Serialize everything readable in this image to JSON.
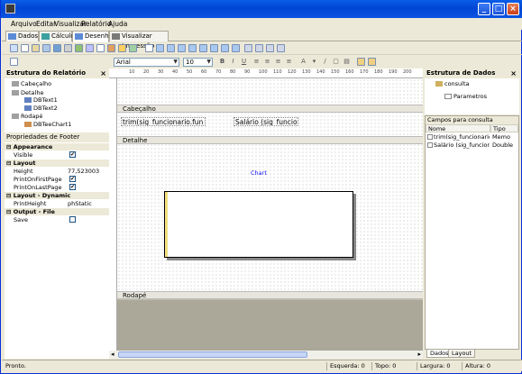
{
  "menu": [
    "Arquivo",
    "Editar",
    "Visualizar",
    "Relatório",
    "Ajuda"
  ],
  "title_buttons": [
    "_",
    "□",
    "×"
  ],
  "tabs": [
    "Dados",
    "Cálculo",
    "Desenho",
    "Visualizar Impressão"
  ],
  "active_tab": "Desenho",
  "font": {
    "family": "Arial",
    "size": "10"
  },
  "format_buttons": [
    "B",
    "I",
    "U"
  ],
  "report_structure": {
    "title": "Estrutura do Relatório",
    "close": "×",
    "nodes": [
      "Cabeçalho",
      "Detalhe",
      "DBText1",
      "DBText2",
      "Rodapé",
      "DBTeeChart1"
    ]
  },
  "properties": {
    "title": "Propriedades de Footer",
    "rows": [
      {
        "type": "cat",
        "label": "Appearance"
      },
      {
        "type": "chk",
        "label": "Visible",
        "value": "✔"
      },
      {
        "type": "cat",
        "label": "Layout"
      },
      {
        "type": "val",
        "label": "Height",
        "value": "77,523003"
      },
      {
        "type": "chk",
        "label": "PrintOnFirstPage",
        "value": "✔"
      },
      {
        "type": "chk",
        "label": "PrintOnLastPage",
        "value": "✔"
      },
      {
        "type": "cat",
        "label": "Layout - Dynamic"
      },
      {
        "type": "val",
        "label": "PrintHeight",
        "value": "phStatic"
      },
      {
        "type": "cat",
        "label": "Output - File"
      },
      {
        "type": "chk",
        "label": "Save",
        "value": ""
      }
    ]
  },
  "ruler_ticks": [
    "10",
    "20",
    "30",
    "40",
    "50",
    "60",
    "70",
    "80",
    "90",
    "100",
    "110",
    "120",
    "130",
    "140",
    "150",
    "160",
    "170",
    "180",
    "190",
    "200"
  ],
  "bands": {
    "header": "Cabeçalho",
    "detail": "Detalhe",
    "footer": "Rodapé"
  },
  "fields": {
    "field1": "trim(sig_funcionario.fun_nome)",
    "field2": "Salário (sig_funcionario"
  },
  "chart_label": "Chart",
  "data_structure": {
    "title": "Estrutura de Dados",
    "close": "×",
    "nodes": [
      "consulta",
      "Parametros"
    ]
  },
  "query": {
    "title": "Campos para consulta",
    "columns": [
      "Nome",
      "Tipo"
    ],
    "rows": [
      {
        "name": "trim(sig_funcionario.f...",
        "type": "Memo"
      },
      {
        "name": "Salário (sig_funcion...",
        "type": "Double"
      }
    ]
  },
  "right_tabs": [
    "Dados",
    "Layout"
  ],
  "status": {
    "text": "Pronto.",
    "esquerda": "Esquerda: 0",
    "topo": "Topo: 0",
    "largura": "Largura: 0",
    "altura": "Altura: 0"
  },
  "colors": {
    "titlebar": "#0054e3",
    "chart_label": "#1010ff",
    "chart_axis": "#f0e080"
  }
}
